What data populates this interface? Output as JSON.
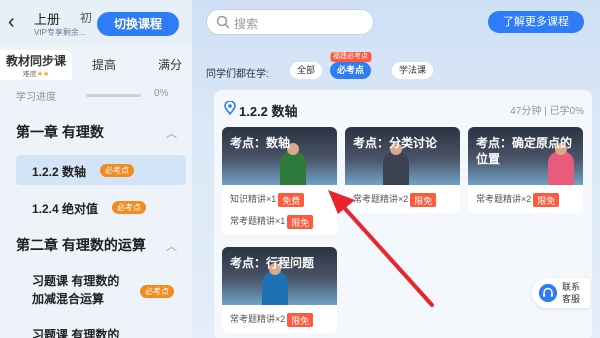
{
  "sidebar": {
    "grade_label": "上册",
    "grade_label2": "初",
    "vip_text": "VIP专享剩余...",
    "switch_button": "切换课程",
    "tabs": {
      "active_label": "教材同步课",
      "difficulty_label": "难度",
      "difficulty_stars": "★★",
      "tab2": "提高",
      "tab3": "满分"
    },
    "progress": {
      "label": "学习进度",
      "value": "0%"
    },
    "chapter1": "第一章 有理数",
    "lesson1": {
      "label": "1.2.2 数轴",
      "badge": "必考点"
    },
    "lesson2": {
      "label": "1.2.4 绝对值",
      "badge": "必考点"
    },
    "chapter2": "第二章 有理数的运算",
    "lesson3": {
      "line1": "习题课 有理数的",
      "line2": "加减混合运算",
      "badge": "必考点"
    },
    "lesson4": {
      "line1": "习题课 有理数的"
    }
  },
  "main": {
    "search_placeholder": "搜索",
    "more_button": "了解更多课程",
    "learn_label": "同学们都在学:",
    "chips": {
      "all": "全部",
      "must": "必考点",
      "must_tag": "福建必考点",
      "method": "学法课"
    },
    "panel": {
      "title": "1.2.2 数轴",
      "duration": "47分钟",
      "learned": "已学0%"
    },
    "cards": [
      {
        "title": "考点：数轴",
        "row1_text": "知识精讲×1",
        "row1_tag": "免费",
        "row2_text": "常考题精讲×1",
        "row2_tag": "限免"
      },
      {
        "title": "考点：分类讨论",
        "row1_text": "常考题精讲×2",
        "row1_tag": "限免"
      },
      {
        "title": "考点：确定原点的位置",
        "row1_text": "常考题精讲×2",
        "row1_tag": "限免"
      },
      {
        "title": "考点：行程问题",
        "row1_text": "常考题精讲×2",
        "row1_tag": "限免"
      }
    ],
    "service": {
      "line1": "联系",
      "line2": "客服"
    }
  },
  "colors": {
    "accent": "#2f7df6",
    "badge_orange": "#f28c1e",
    "tag_red": "#ff5a3c",
    "arrow": "#e8252a"
  }
}
